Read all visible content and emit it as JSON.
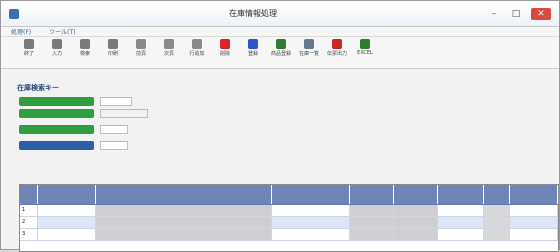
{
  "window": {
    "title": "在庫情報処理"
  },
  "menu": [
    "処理(F)",
    "ツール(T)"
  ],
  "toolbar": [
    {
      "label": "終了",
      "color": "#7a7a7a"
    },
    {
      "label": "入力",
      "color": "#7a7a7a"
    },
    {
      "label": "検索",
      "color": "#7a7a7a"
    },
    {
      "label": "印刷",
      "color": "#7a7a7a"
    },
    {
      "label": "前頁",
      "color": "#8a8a8a"
    },
    {
      "label": "次頁",
      "color": "#8a8a8a"
    },
    {
      "label": "行追加",
      "color": "#8a8a8a"
    },
    {
      "label": "削除",
      "color": "#d8252a"
    },
    {
      "label": "登録",
      "color": "#2a56c6"
    },
    {
      "label": "商品登録",
      "color": "#2e7d32"
    },
    {
      "label": "在庫一覧",
      "color": "#607d8b"
    },
    {
      "label": "伝票出力",
      "color": "#c62828"
    },
    {
      "label": "EXCEL",
      "color": "#2e7d32"
    }
  ],
  "section": {
    "title": "在庫検索キー"
  },
  "form": {
    "r1": {
      "label": "",
      "hint": ""
    },
    "r2": {
      "label": "",
      "hint": ""
    },
    "r3": {
      "label": "",
      "hint": ""
    },
    "r4": {
      "label": "",
      "hint": ""
    }
  },
  "note": "",
  "table": {
    "headers": [
      "",
      "",
      "",
      "",
      "",
      "",
      "",
      "",
      ""
    ],
    "rows": [
      [
        "1",
        "",
        "",
        "",
        "",
        "",
        "",
        "",
        ""
      ],
      [
        "2",
        "",
        "",
        "",
        "",
        "",
        "",
        "",
        ""
      ],
      [
        "3",
        "",
        "",
        "",
        "",
        "",
        "",
        "",
        ""
      ]
    ]
  }
}
